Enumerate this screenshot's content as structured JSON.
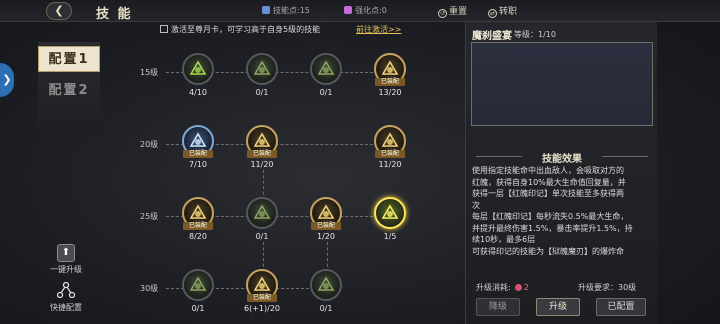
{
  "header": {
    "back_icon": "back-arrow-icon",
    "title": "技 能",
    "skill_points": "技能点:15",
    "enhance_points": "强化点:0",
    "reset_label": "重置",
    "transfer_label": "转职"
  },
  "sidebar": {
    "config_tabs": [
      "配置1",
      "配置2"
    ],
    "one_click_upgrade": "一键升级",
    "quick_config": "快捷配置"
  },
  "notice": {
    "text": "激活至尊月卡，可学习高于自身5级的技能",
    "link": "前往激活>>"
  },
  "skill_tree": {
    "equipped_tag": "已装配",
    "rows": [
      {
        "level": "15级",
        "skills": [
          {
            "icon": "sword-strike-icon",
            "value": "4/10",
            "equipped": false,
            "style": "green"
          },
          {
            "icon": "axe-spin-icon",
            "value": "0/1",
            "equipped": false,
            "style": "grey"
          },
          {
            "icon": "vine-burst-icon",
            "value": "0/1",
            "equipped": false,
            "style": "grey"
          },
          {
            "icon": "fire-fist-icon",
            "value": "13/20",
            "equipped": true,
            "style": "gold"
          }
        ]
      },
      {
        "level": "20级",
        "skills": [
          {
            "icon": "frost-aura-icon",
            "value": "7/10",
            "equipped": true,
            "style": "blue"
          },
          {
            "icon": "golden-slash-icon",
            "value": "11/20",
            "equipped": true,
            "style": "gold"
          },
          {
            "icon": "flame-ring-icon",
            "value": "11/20",
            "equipped": true,
            "style": "gold"
          }
        ]
      },
      {
        "level": "25级",
        "skills": [
          {
            "icon": "whirl-blade-icon",
            "value": "8/20",
            "equipped": true,
            "style": "gold"
          },
          {
            "icon": "earth-spike-icon",
            "value": "0/1",
            "equipped": false,
            "style": "grey"
          },
          {
            "icon": "wing-guard-icon",
            "value": "1/20",
            "equipped": true,
            "style": "gold"
          },
          {
            "icon": "blood-feast-icon",
            "value": "1/5",
            "equipped": false,
            "style": "glow"
          }
        ]
      },
      {
        "level": "30级",
        "skills": [
          {
            "icon": "storm-icon",
            "value": "0/1",
            "equipped": false,
            "style": "grey"
          },
          {
            "icon": "thunder-blade-icon",
            "value": "6(+1)/20",
            "equipped": true,
            "style": "gold"
          },
          {
            "icon": "beast-summon-icon",
            "value": "0/1",
            "equipped": false,
            "style": "grey"
          }
        ]
      }
    ]
  },
  "detail": {
    "name": "魔刹盛宴",
    "level_text": "等级：1/10",
    "effect_header": "技能效果",
    "desc_lines": [
      "使用指定技能命中出血敌人，会吸取对方的",
      "红魄，获得自身10%最大生命值回复量，并",
      "获得一层【红魄印记】单次技能至多获得两",
      "次",
      "每层【红魄印记】每秒流失0.5%最大生命，",
      "并提升最终伤害1.5%，暴击率提升1.5%，持",
      "续10秒，最多6层",
      "可获得印记的技能为【狱魄魔刃】的爆炸命"
    ],
    "cost_label": "升级消耗:",
    "cost_value": "2",
    "requirement": "升级要求：30级",
    "btn_downgrade": "降级",
    "btn_upgrade": "升级",
    "btn_config": "已配置"
  },
  "colors": {
    "accent_gold": "#c6a55d",
    "link_gold": "#e6c35a",
    "glow_yellow": "#ffe45c",
    "cost_red": "#e27b6b",
    "side_blue": "#2d6fb5"
  }
}
